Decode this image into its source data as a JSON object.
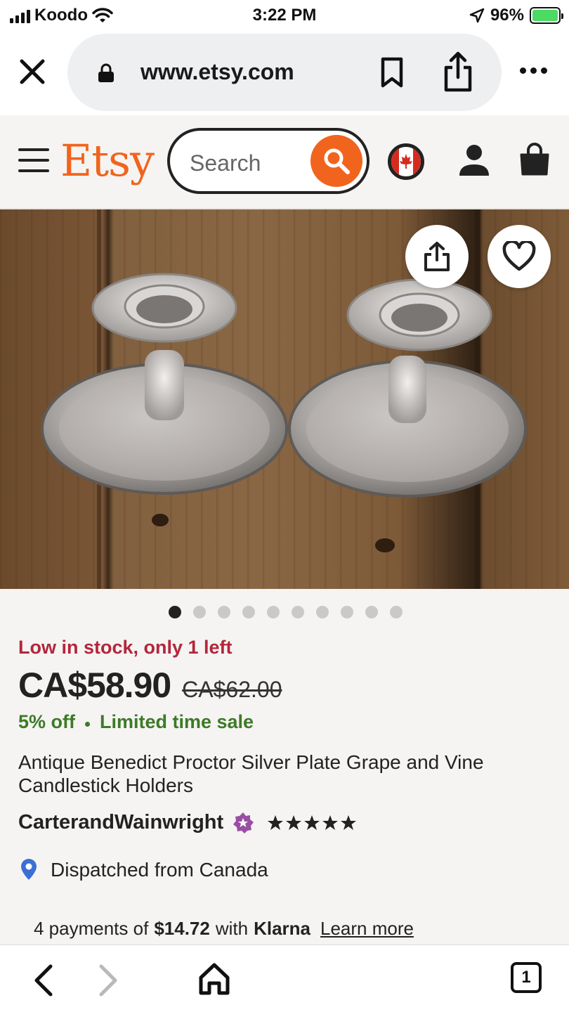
{
  "status_bar": {
    "carrier": "Koodo",
    "time": "3:22 PM",
    "battery": "96%"
  },
  "browser": {
    "url": "www.etsy.com",
    "tab_count": "1"
  },
  "header": {
    "logo": "Etsy",
    "search_placeholder": "Search"
  },
  "carousel": {
    "total": 10,
    "active_index": 0
  },
  "listing": {
    "stock_notice": "Low in stock, only 1 left",
    "price": "CA$58.90",
    "original_price": "CA$62.00",
    "discount": "5% off",
    "sale_label": "Limited time sale",
    "title": "Antique Benedict Proctor Silver Plate Grape and Vine Candlestick Holders",
    "shop_name": "CarterandWainwright",
    "rating": 5,
    "dispatch": "Dispatched from Canada"
  },
  "payments": {
    "prefix": "4 payments of",
    "amount": "$14.72",
    "middle": "with",
    "provider": "Klarna",
    "link": "Learn more"
  },
  "colors": {
    "brand": "#f1641e",
    "stock": "#b3263d",
    "sale": "#3d7a28",
    "star_seller": "#9a4ea3",
    "pin": "#3b6fd6"
  },
  "icons": [
    "close-icon",
    "lock-icon",
    "bookmark-icon",
    "share-icon",
    "more-icon",
    "menu-icon",
    "search-icon",
    "canada-flag-icon",
    "account-icon",
    "cart-icon",
    "heart-icon",
    "star-seller-icon",
    "star-icon",
    "location-pin-icon",
    "back-icon",
    "forward-icon",
    "home-icon",
    "tabs-icon"
  ]
}
